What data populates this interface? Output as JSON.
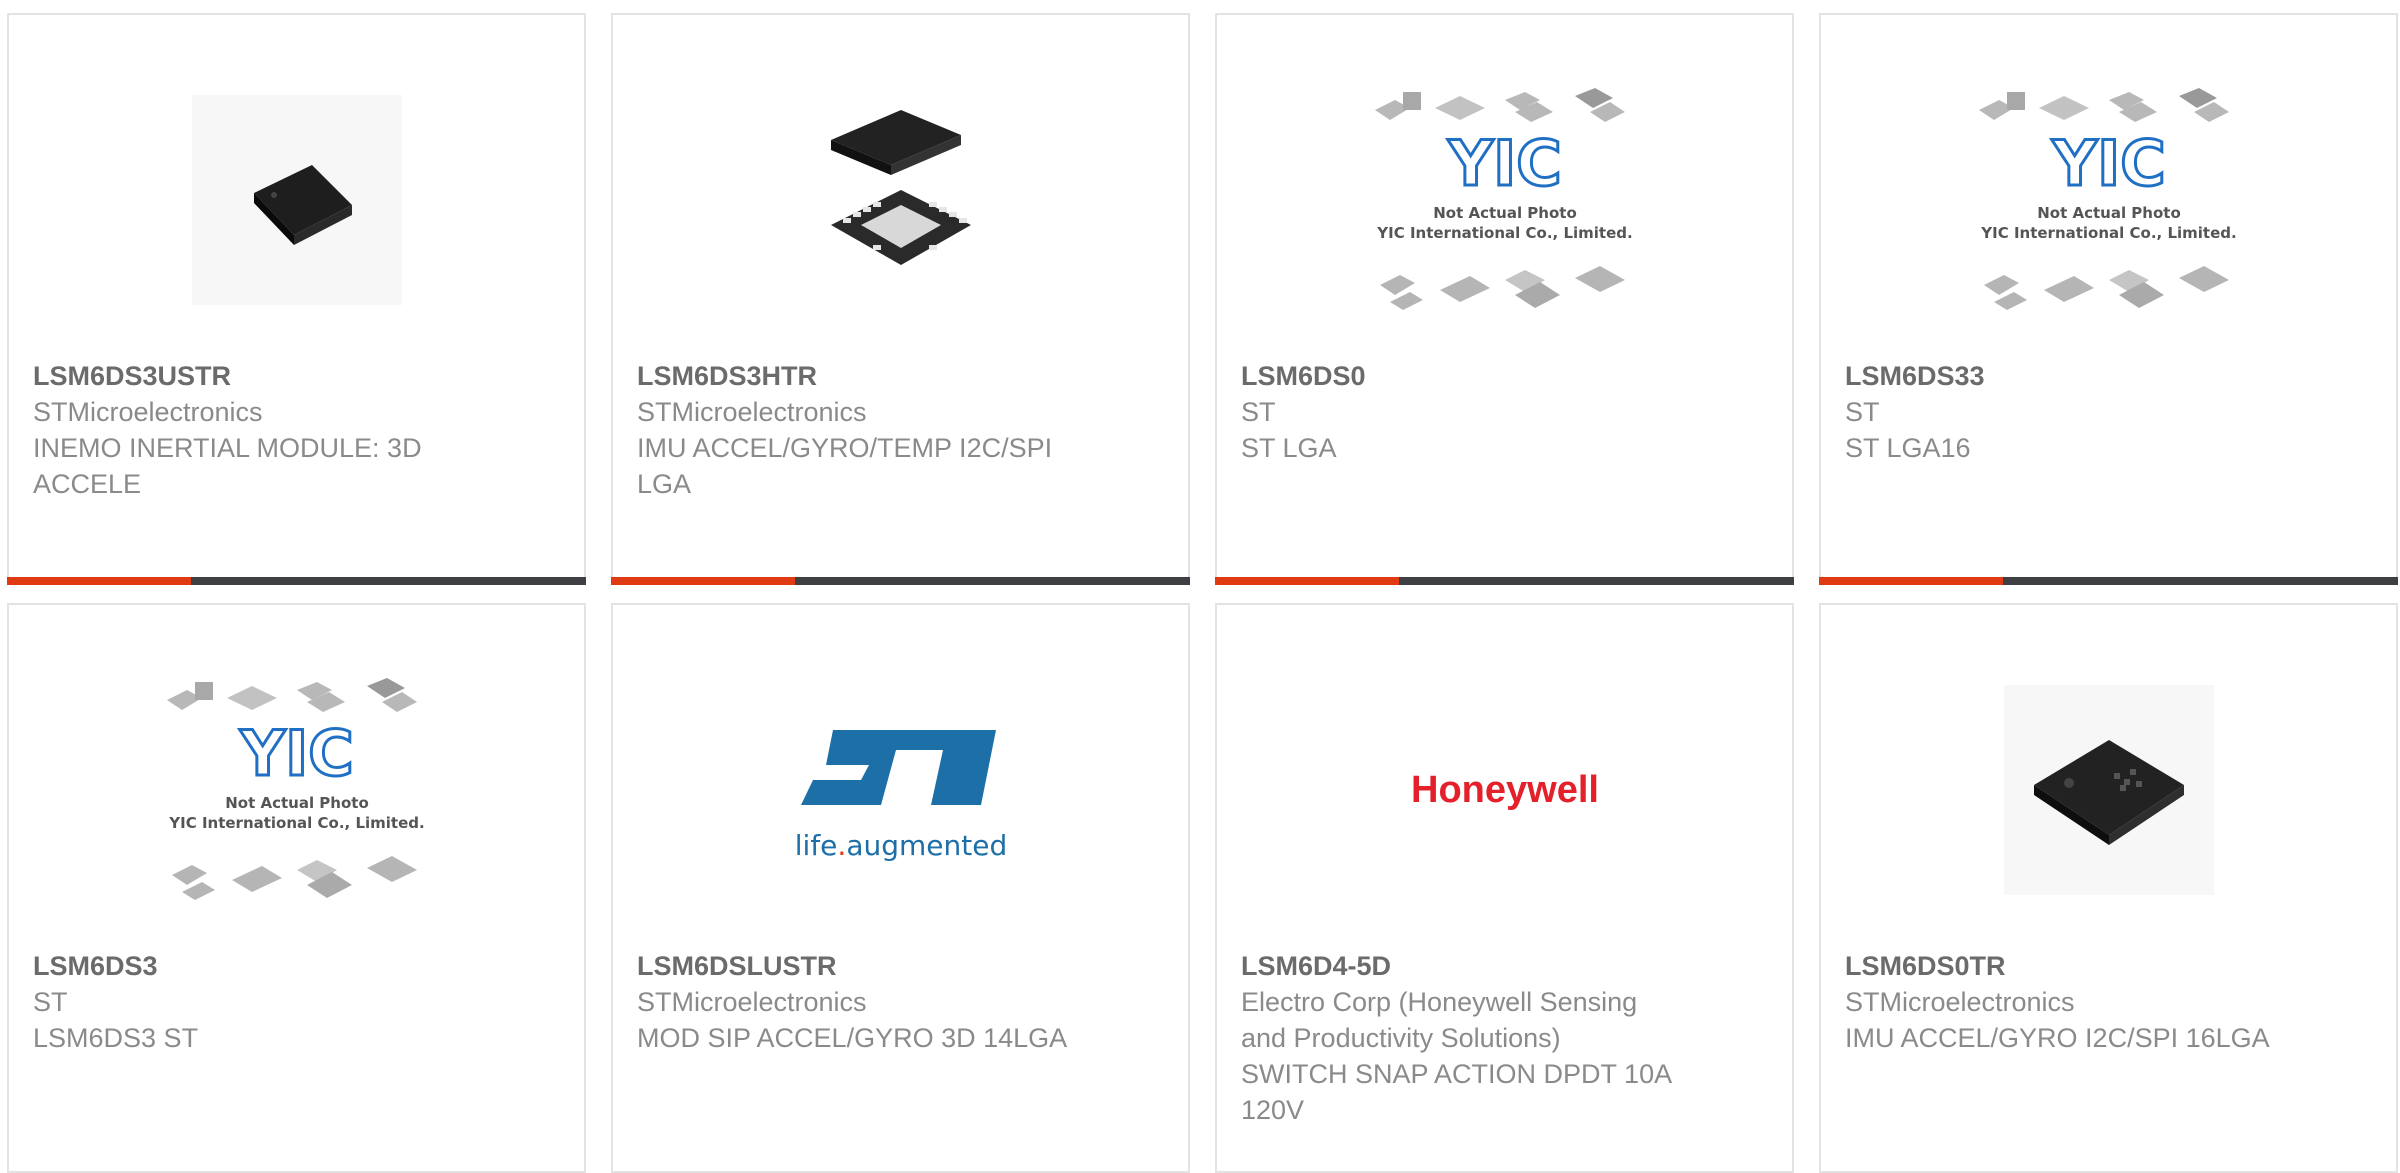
{
  "products": [
    {
      "part": "LSM6DS3USTR",
      "maker": "STMicroelectronics",
      "desc": "INEMO INERTIAL MODULE: 3D ACCELE",
      "image": "chip-photo-lga"
    },
    {
      "part": "LSM6DS3HTR",
      "maker": "STMicroelectronics",
      "desc": "IMU ACCEL/GYRO/TEMP I2C/SPI LGA",
      "image": "chip-photo-qfn-pads"
    },
    {
      "part": "LSM6DS0",
      "maker": "ST",
      "desc": "ST LGA",
      "image": "yic-placeholder"
    },
    {
      "part": "LSM6DS33",
      "maker": "ST",
      "desc": "ST LGA16",
      "image": "yic-placeholder"
    },
    {
      "part": "LSM6DS3",
      "maker": "ST",
      "desc": "LSM6DS3 ST",
      "image": "yic-placeholder"
    },
    {
      "part": "LSM6DSLUSTR",
      "maker": "STMicroelectronics",
      "desc": "MOD SIP ACCEL/GYRO 3D 14LGA",
      "image": "st-logo"
    },
    {
      "part": "LSM6D4-5D",
      "maker": "Electro Corp (Honeywell Sensing and Productivity Solutions)",
      "desc": "SWITCH SNAP ACTION DPDT 10A 120V",
      "image": "honeywell-logo"
    },
    {
      "part": "LSM6DS0TR",
      "maker": "STMicroelectronics",
      "desc": "IMU ACCEL/GYRO I2C/SPI 16LGA",
      "image": "chip-photo-lga"
    }
  ],
  "placeholder": {
    "logo_text": "YIC",
    "line1": "Not Actual Photo",
    "line2": "YIC International Co., Limited."
  },
  "brands": {
    "st_tagline_a": "life",
    "st_tagline_dot": ".",
    "st_tagline_b": "augmented",
    "honeywell": "Honeywell"
  },
  "colors": {
    "accent": "#e03a12",
    "bar": "#3d3f42",
    "part_text": "#6b6b6b",
    "secondary_text": "#8a8a8a",
    "st_blue": "#1d6fa8",
    "honeywell_red": "#e4202a",
    "yic_blue": "#1f6fc4"
  }
}
